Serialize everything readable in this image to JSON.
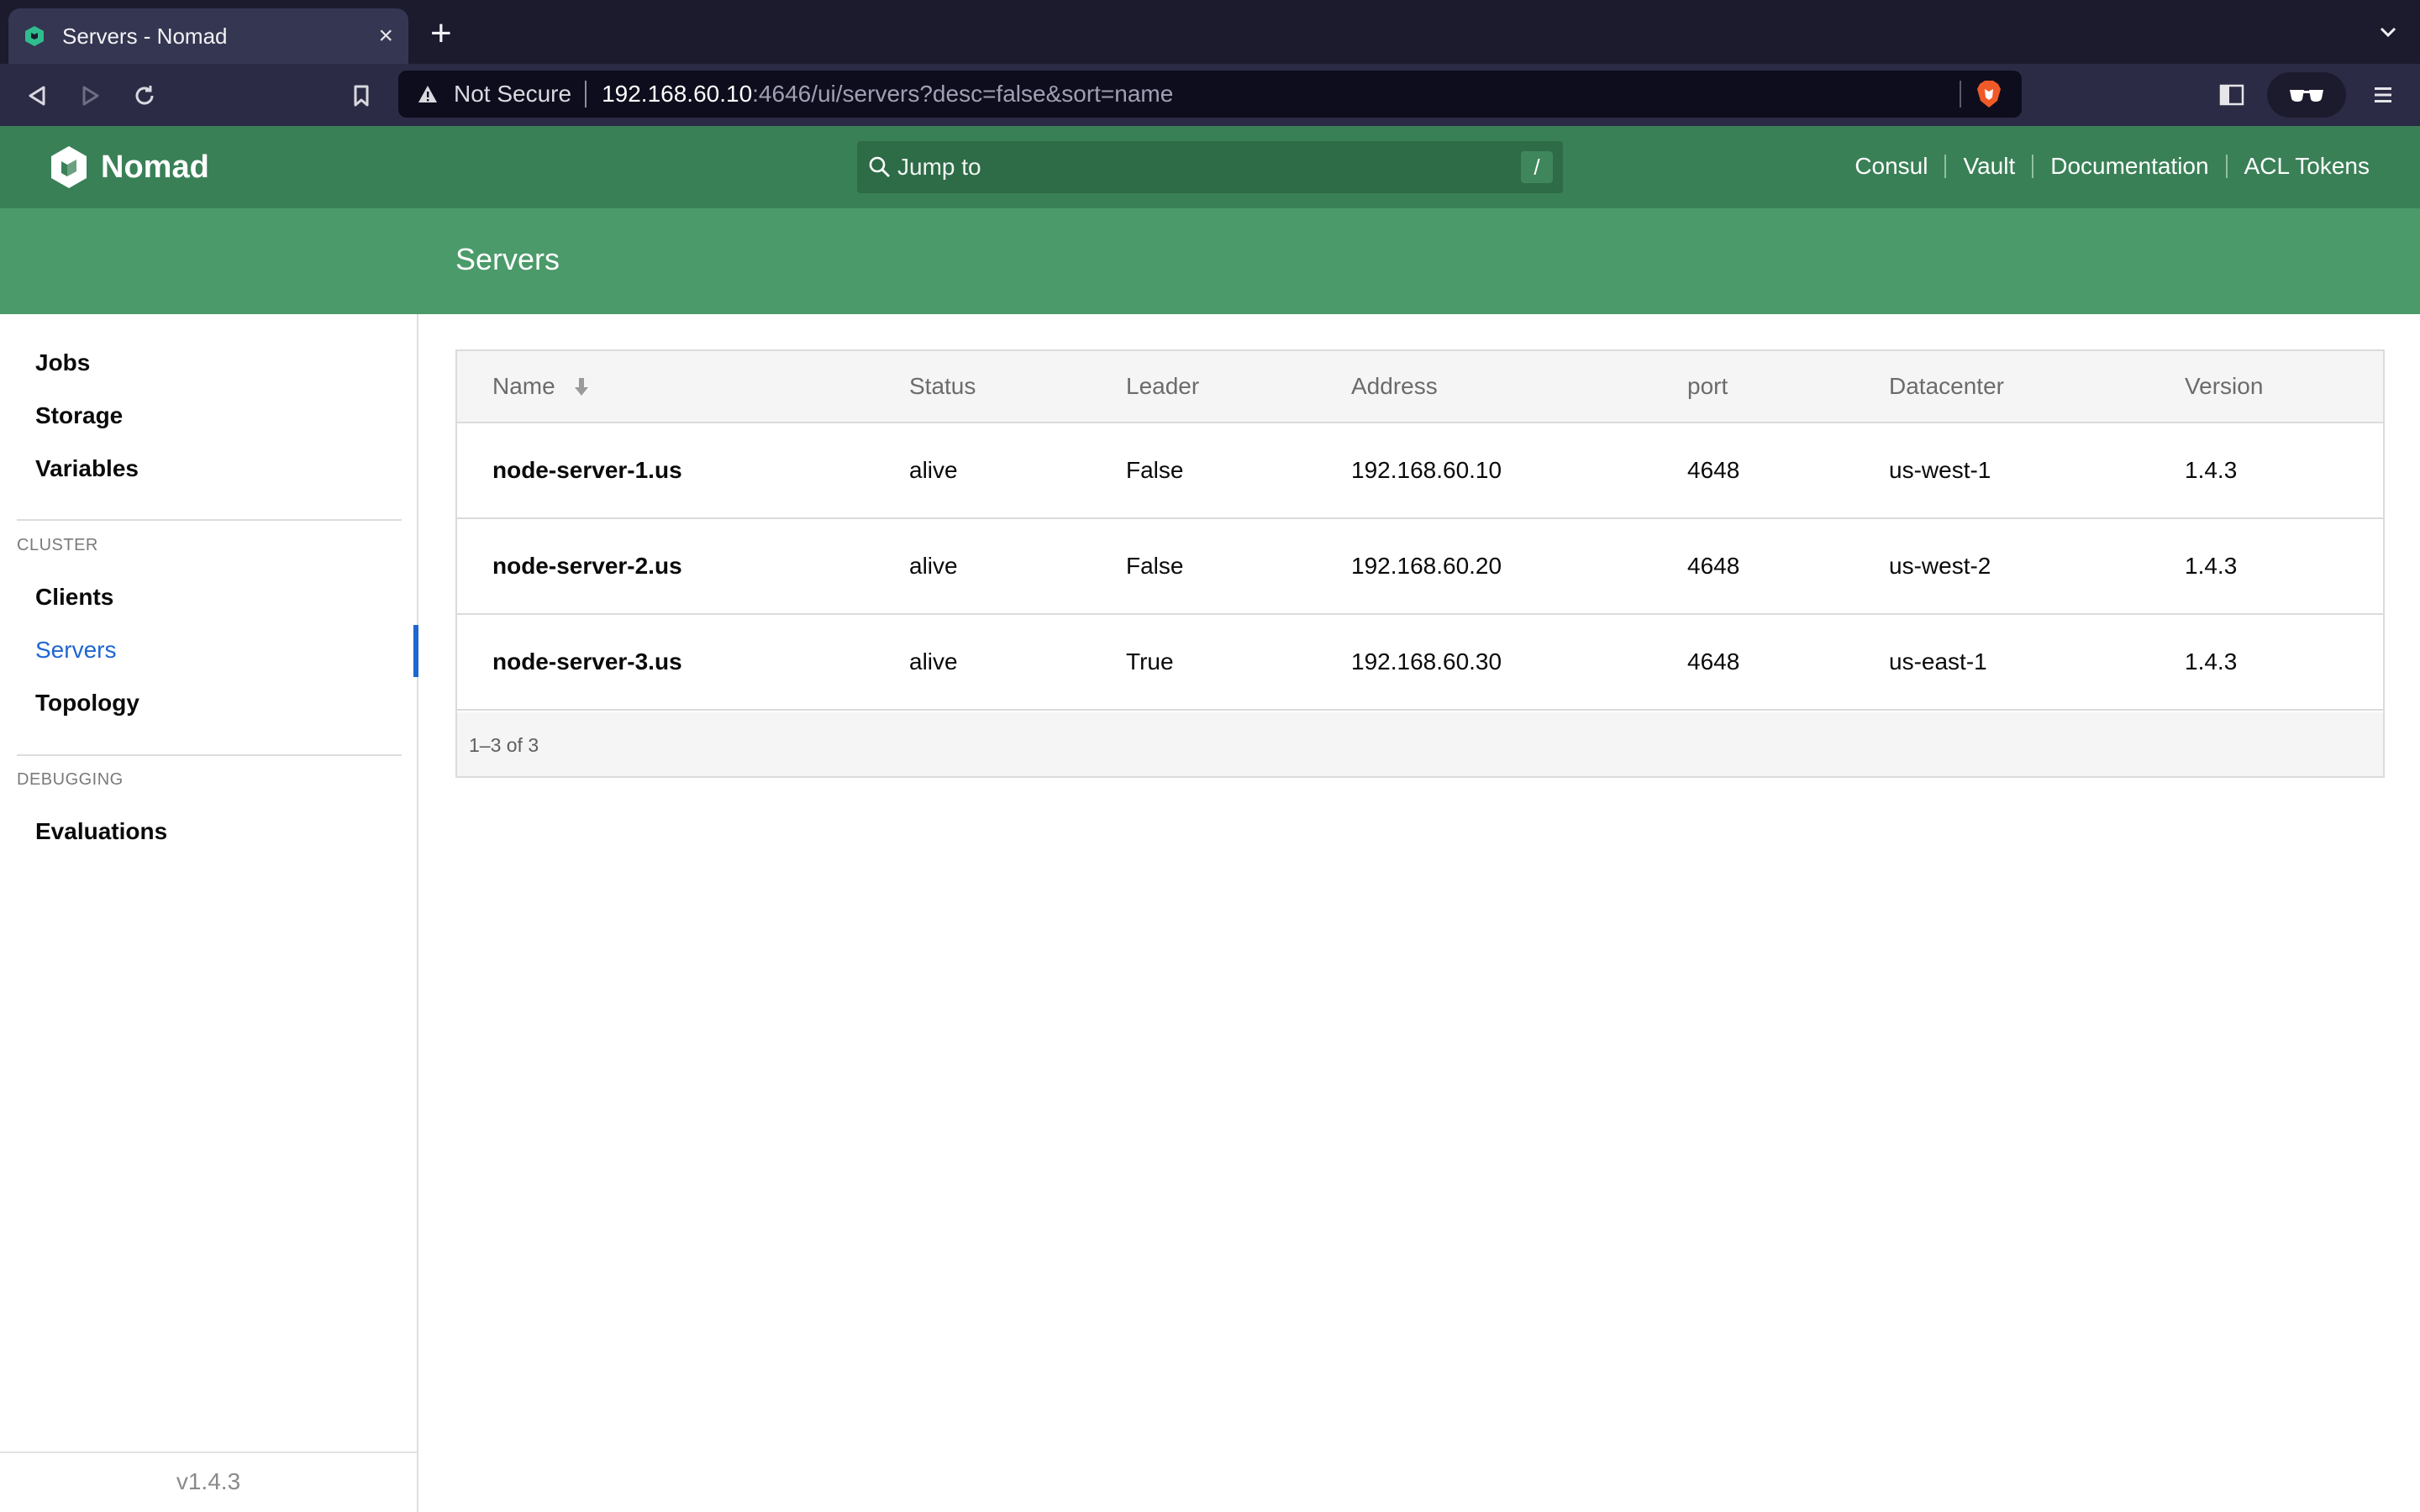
{
  "browser": {
    "tab_title": "Servers - Nomad",
    "tab_close": "×",
    "new_tab": "+",
    "url_not_secure": "Not Secure",
    "url_host": "192.168.60.10",
    "url_rest": ":4646/ui/servers?desc=false&sort=name"
  },
  "header": {
    "logo_text": "Nomad",
    "search_placeholder": "Jump to",
    "search_shortcut": "/",
    "links": [
      "Consul",
      "Vault",
      "Documentation",
      "ACL Tokens"
    ]
  },
  "page_title": "Servers",
  "sidebar": {
    "items_top": [
      "Jobs",
      "Storage",
      "Variables"
    ],
    "cluster_label": "CLUSTER",
    "cluster_items": [
      "Clients",
      "Servers",
      "Topology"
    ],
    "active_item": "Servers",
    "debugging_label": "DEBUGGING",
    "debugging_items": [
      "Evaluations"
    ],
    "version": "v1.4.3"
  },
  "table": {
    "columns": [
      "Name",
      "Status",
      "Leader",
      "Address",
      "port",
      "Datacenter",
      "Version"
    ],
    "sorted_column": "Name",
    "rows": [
      [
        "node-server-1.us",
        "alive",
        "False",
        "192.168.60.10",
        "4648",
        "us-west-1",
        "1.4.3"
      ],
      [
        "node-server-2.us",
        "alive",
        "False",
        "192.168.60.20",
        "4648",
        "us-west-2",
        "1.4.3"
      ],
      [
        "node-server-3.us",
        "alive",
        "True",
        "192.168.60.30",
        "4648",
        "us-east-1",
        "1.4.3"
      ]
    ],
    "pagination": "1–3 of 3"
  },
  "colors": {
    "header_green": "#3a8057",
    "subheader_green": "#4a9a6a",
    "active_blue": "#1f66d1"
  },
  "icons": [
    "nomad-logo-icon",
    "search-icon",
    "sort-down-icon",
    "back-icon",
    "forward-icon",
    "reload-icon",
    "bookmark-icon",
    "warning-icon",
    "brave-shield-icon",
    "sidebar-toggle-icon",
    "glasses-icon",
    "menu-icon"
  ]
}
